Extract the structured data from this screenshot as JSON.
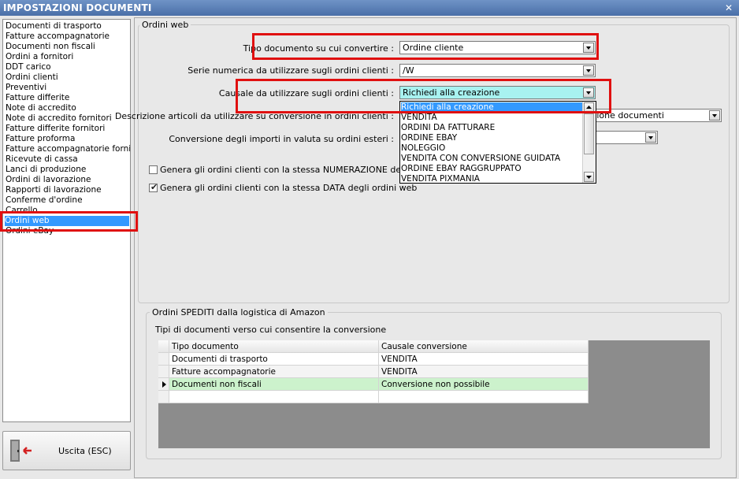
{
  "window": {
    "title": "IMPOSTAZIONI DOCUMENTI",
    "close_glyph": "✕"
  },
  "sidebar": {
    "items": [
      "Documenti di trasporto",
      "Fatture accompagnatorie",
      "Documenti non fiscali",
      "Ordini a fornitori",
      "DDT carico",
      "Ordini clienti",
      "Preventivi",
      "Fatture differite",
      "Note di accredito",
      "Note di accredito fornitori",
      "Fatture differite fornitori",
      "Fatture proforma",
      "Fatture accompagnatorie fornitori",
      "Ricevute di cassa",
      "Lanci di produzione",
      "Ordini di lavorazione",
      "Rapporti di lavorazione",
      "Conferme d'ordine",
      "Carrello",
      "Ordini web",
      "Ordini eBay"
    ],
    "selected_index": 19
  },
  "exit_button": {
    "label": "Uscita (ESC)",
    "icon": "exit-door-icon"
  },
  "ordini_web": {
    "legend": "Ordini web",
    "tipo_documento": {
      "label": "Tipo documento su cui convertire :",
      "value": "Ordine cliente"
    },
    "serie_numerica": {
      "label": "Serie numerica da utilizzare sugli ordini clienti :",
      "value": "/W"
    },
    "causale": {
      "label": "Causale da utilizzare sugli ordini clienti :",
      "value": "Richiedi alla creazione"
    },
    "descrizione": {
      "label": "Descrizione articoli da utilizzare su conversione in ordini clienti :",
      "value": "rizione documenti"
    },
    "conversione_importi": {
      "label": "Conversione degli importi in valuta su ordini esteri :",
      "value": ""
    },
    "chk_numerazione": {
      "label": "Genera gli ordini clienti con la stessa NUMERAZIONE degli ordini",
      "checked": false
    },
    "chk_data": {
      "label": "Genera gli ordini clienti con la stessa DATA degli ordini web",
      "checked": true
    }
  },
  "causale_dropdown": {
    "options": [
      "Richiedi alla creazione",
      "VENDITA",
      "ORDINI DA FATTURARE",
      "ORDINE EBAY",
      "NOLEGGIO",
      "VENDITA CON CONVERSIONE GUIDATA",
      "ORDINE EBAY RAGGRUPPATO",
      "VENDITA PIXMANIA"
    ],
    "selected_index": 0
  },
  "amazon": {
    "legend": "Ordini SPEDITI dalla logistica di Amazon",
    "subtitle": "Tipi di documenti verso cui consentire la conversione",
    "columns": [
      "Tipo documento",
      "Causale conversione"
    ],
    "rows": [
      [
        "Documenti di trasporto",
        "VENDITA"
      ],
      [
        "Fatture accompagnatorie",
        "VENDITA"
      ],
      [
        "Documenti non fiscali",
        "Conversione non possibile"
      ]
    ],
    "current_row": 2
  },
  "colors": {
    "highlight": "#e01010",
    "selection": "#3399ff",
    "active_row": "#ccf2cc",
    "combo_active": "#a8f2f0"
  }
}
